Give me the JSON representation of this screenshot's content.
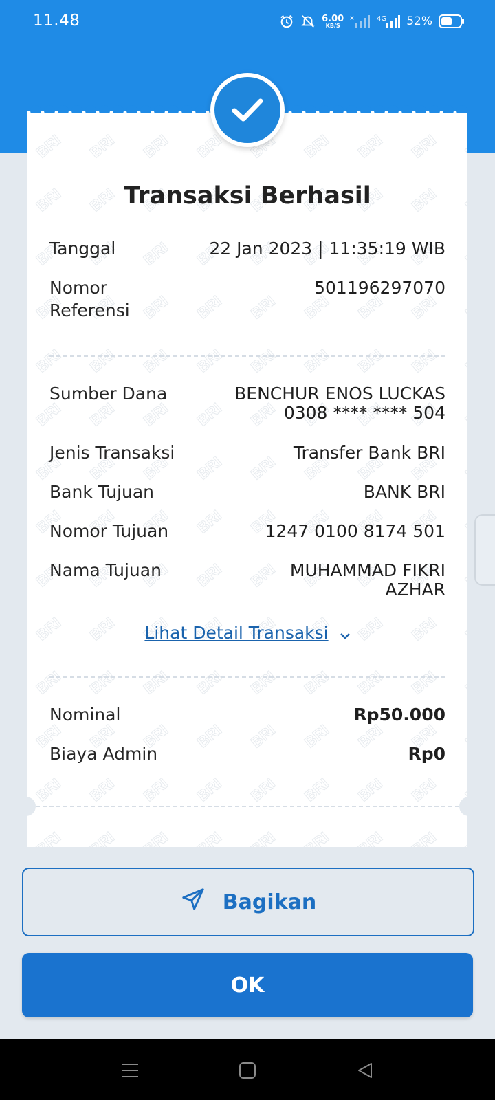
{
  "status_bar": {
    "time": "11.48",
    "net_speed_value": "6.00",
    "net_speed_unit": "KB/S",
    "battery_percent": "52%"
  },
  "receipt": {
    "title": "Transaksi Berhasil",
    "rows": [
      {
        "label": "Tanggal",
        "value": "22 Jan 2023 | 11:35:19 WIB"
      },
      {
        "label": "Nomor\nReferensi",
        "value": "501196297070"
      },
      {
        "label": "Sumber Dana",
        "value": "BENCHUR ENOS LUCKAS\n0308 **** **** 504"
      },
      {
        "label": "Jenis Transaksi",
        "value": "Transfer Bank BRI"
      },
      {
        "label": "Bank Tujuan",
        "value": "BANK BRI"
      },
      {
        "label": "Nomor Tujuan",
        "value": "1247 0100 8174 501"
      },
      {
        "label": "Nama Tujuan",
        "value": "MUHAMMAD FIKRI\nAZHAR"
      },
      {
        "label": "Nominal",
        "value": "Rp50.000"
      },
      {
        "label": "Biaya Admin",
        "value": "Rp0"
      }
    ],
    "detail_link": "Lihat Detail Transaksi"
  },
  "actions": {
    "share_label": "Bagikan",
    "ok_label": "OK"
  },
  "colors": {
    "brand_blue": "#1f8be6",
    "button_blue": "#1a73cf",
    "link_blue": "#1a63ad",
    "background": "#e3e9ef"
  },
  "icons": [
    "alarm-icon",
    "mute-icon",
    "signal-icon",
    "battery-icon",
    "check-icon",
    "chevron-down-icon",
    "send-icon",
    "menu-icon",
    "home-icon",
    "back-icon"
  ]
}
